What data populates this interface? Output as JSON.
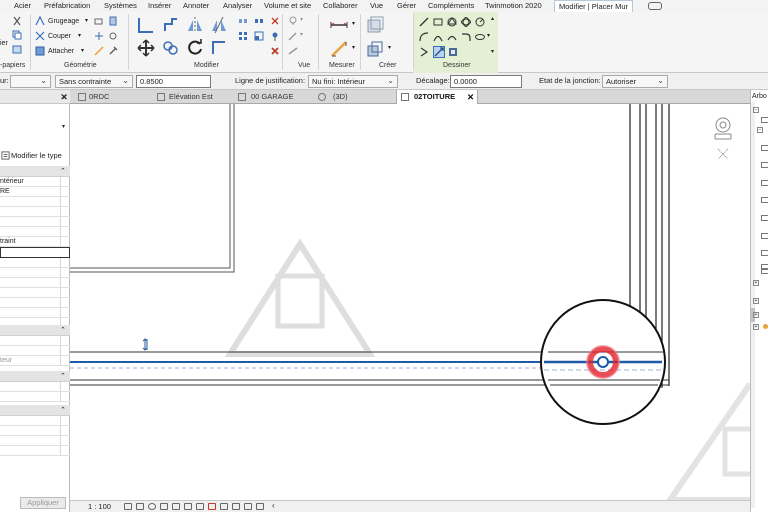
{
  "menu": {
    "tabs": [
      "Acier",
      "Préfabrication",
      "Systèmes",
      "Insérer",
      "Annoter",
      "Analyser",
      "Volume et site",
      "Collaborer",
      "Vue",
      "Gérer",
      "Compléments",
      "Twinmotion 2020"
    ],
    "active_tab": "Modifier | Placer Mur"
  },
  "ribbon": {
    "clipboard_label": "-papiers",
    "clipboard_partial_top": "ier",
    "geometry_items": [
      "Grugeage",
      "Couper",
      "Attacher"
    ],
    "panels": [
      "Géométrie",
      "Modifier",
      "Vue",
      "Mesurer",
      "Créer",
      "Dessiner"
    ],
    "accent": "#e3f0d4"
  },
  "options": {
    "first_label": "ur:",
    "constraint": "Sans contrainte",
    "height_value": "0.8500",
    "justification_label": "Ligne de justification:",
    "justification_value": "Nu fini: Intérieur",
    "offset_label": "Décalage:",
    "offset_value": "0.0000",
    "junction_label": "Etat de la jonction:",
    "junction_value": "Autoriser"
  },
  "properties": {
    "edit_type_label": "Modifier le type",
    "rows": [
      "ntérieur",
      "RE",
      "traint",
      "teur"
    ],
    "apply_label": "Appliquer"
  },
  "view_tabs": [
    "0RDC",
    "Elévation Est",
    "00 GARAGE",
    "(3D)",
    "02TOITURE"
  ],
  "browser": {
    "title": "Arbo"
  },
  "status": {
    "scale": "1 : 100"
  },
  "colors": {
    "wall_selected": "#1f5aa8",
    "highlight_red": "#e4202a",
    "watermark": "#d9d9d9"
  }
}
